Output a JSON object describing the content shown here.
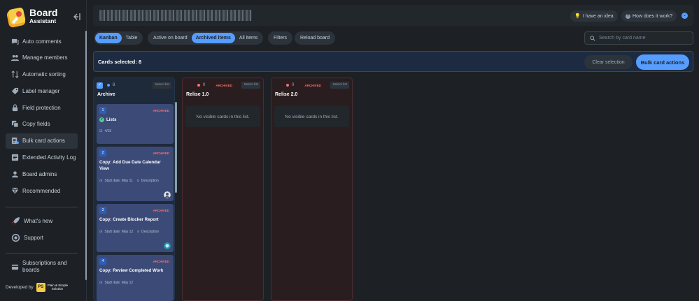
{
  "brand": {
    "line1": "Board",
    "line2": "Assistant"
  },
  "sidebar": {
    "items": [
      {
        "label": "Auto comments",
        "icon": "comments-icon"
      },
      {
        "label": "Manage members",
        "icon": "members-icon"
      },
      {
        "label": "Automatic sorting",
        "icon": "sort-icon"
      },
      {
        "label": "Label manager",
        "icon": "label-icon"
      },
      {
        "label": "Field protection",
        "icon": "lock-icon"
      },
      {
        "label": "Copy fields",
        "icon": "copy-icon"
      },
      {
        "label": "Bulk card actions",
        "icon": "bulk-icon"
      },
      {
        "label": "Extended Activity Log",
        "icon": "activity-log-icon"
      },
      {
        "label": "Board admins",
        "icon": "admin-icon"
      },
      {
        "label": "Recommended",
        "icon": "diamond-icon"
      }
    ],
    "active_index": 6,
    "extra": [
      {
        "label": "What's new",
        "icon": "rocket-icon"
      },
      {
        "label": "Support",
        "icon": "support-icon"
      }
    ],
    "subscriptions": {
      "label": "Subscriptions and boards",
      "icon": "card-icon"
    },
    "developed_by": "Developed by",
    "dev_logo_mark": "PS",
    "dev_logo_text1": "Plain & Simple",
    "dev_logo_text2": "Solution"
  },
  "topbar": {
    "idea_label": "I have an idea",
    "how_label": "How does it work?"
  },
  "toolbar": {
    "view_tabs": [
      "Kanban",
      "Table"
    ],
    "filter_tabs": [
      "Active on board",
      "Archived items",
      "All items"
    ],
    "filters_label": "Filters",
    "reload_label": "Reload board",
    "search_placeholder": "Search by card name"
  },
  "selection": {
    "count_text": "Cards selected: 8",
    "clear_label": "Clear selection",
    "bulk_label": "Bulk card actions"
  },
  "colors": {
    "accent": "#579dff",
    "archived": "#f87168",
    "blue_dot": "#579dff",
    "red_dot": "#f87168"
  },
  "lists": [
    {
      "title": "Archive",
      "count": "8",
      "select_label": "Select list"
    },
    {
      "title": "Relise 1.0",
      "count": "0",
      "archived_tag": "ARCHIVED",
      "select_label": "Select list",
      "empty_text": "No visible cards in this list."
    },
    {
      "title": "Relise 2.0",
      "count": "0",
      "archived_tag": "ARCHIVED",
      "select_label": "Select list",
      "empty_text": "No visible cards in this list."
    }
  ],
  "cards": [
    {
      "num": "1",
      "tag": "ARCHIVED",
      "title": "Lists",
      "checklist": "4/15"
    },
    {
      "num": "2",
      "tag": "ARCHIVED",
      "title": "Copy: Add Due Date Calendar View",
      "start": "Start date: May 11",
      "desc": "Description"
    },
    {
      "num": "3",
      "tag": "ARCHIVED",
      "title": "Copy: Create Blocker Report",
      "start": "Start date: May 12",
      "desc": "Description"
    },
    {
      "num": "4",
      "tag": "ARCHIVED",
      "title": "Copy: Review Completed Work",
      "start": "Start date: May 12"
    }
  ]
}
